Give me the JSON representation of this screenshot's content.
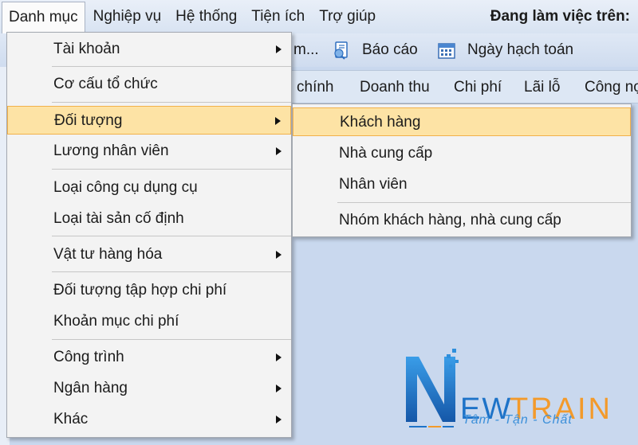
{
  "menubar": {
    "items": [
      "Danh mục",
      "Nghiệp vụ",
      "Hệ thống",
      "Tiện ích",
      "Trợ giúp"
    ],
    "working_on": "Đang làm việc trên:"
  },
  "toolbar": {
    "partial_label": "m...",
    "report_label": "Báo cáo",
    "posting_date_label": "Ngày hạch toán"
  },
  "tabs": [
    "chính",
    "Doanh thu",
    "Chi phí",
    "Lãi lỗ",
    "Công nợ"
  ],
  "dropdown": {
    "items": [
      {
        "label": "Tài khoản",
        "submenu": true
      },
      {
        "label": "Cơ cấu tổ chức",
        "submenu": false
      },
      {
        "label": "Đối tượng",
        "submenu": true
      },
      {
        "label": "Lương nhân viên",
        "submenu": true
      },
      {
        "label": "Loại công cụ dụng cụ",
        "submenu": false
      },
      {
        "label": "Loại tài sản cố định",
        "submenu": false
      },
      {
        "label": "Vật tư hàng hóa",
        "submenu": true
      },
      {
        "label": "Đối tượng tập hợp chi phí",
        "submenu": false
      },
      {
        "label": "Khoản mục chi phí",
        "submenu": false
      },
      {
        "label": "Công trình",
        "submenu": true
      },
      {
        "label": "Ngân hàng",
        "submenu": true
      },
      {
        "label": "Khác",
        "submenu": true
      }
    ],
    "highlighted": "Đối tượng"
  },
  "submenu": {
    "items": [
      "Khách hàng",
      "Nhà cung cấp",
      "Nhân viên",
      "Nhóm khách hàng, nhà cung cấp"
    ],
    "highlighted": "Khách hàng"
  },
  "logo": {
    "brand": "NEWTRAIN",
    "tagline": "Tâm - Tận - Chất"
  },
  "colors": {
    "highlight_fill": "#fde3a5",
    "highlight_border": "#f2b04a",
    "logo_blue": "#1e73c8",
    "logo_orange": "#f39a2b"
  }
}
